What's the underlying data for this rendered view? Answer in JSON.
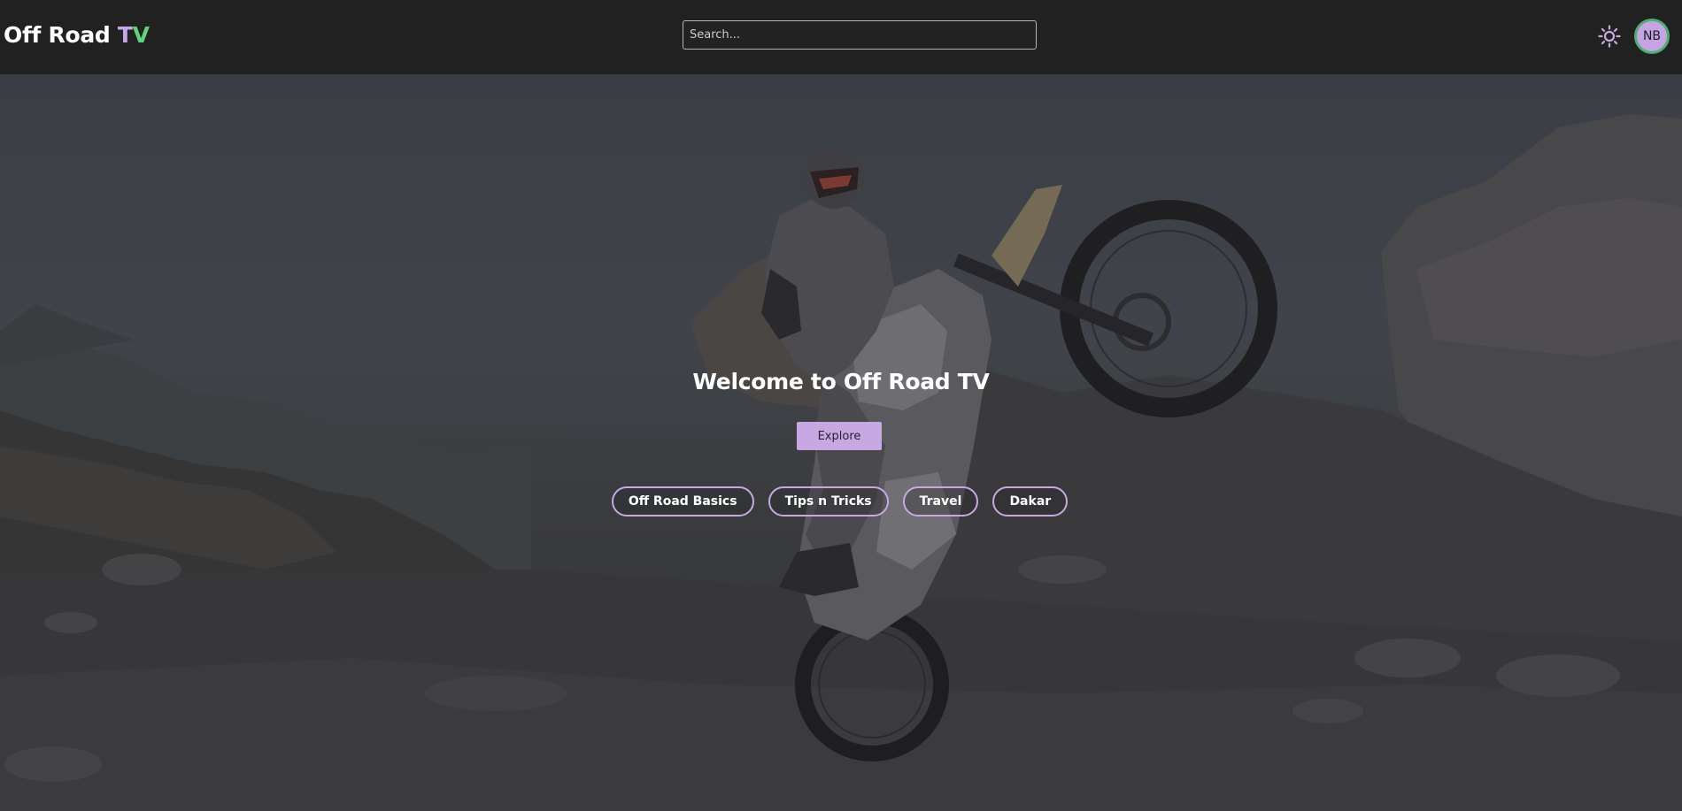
{
  "brand": {
    "name_prefix": "Off Road ",
    "name_t": "T",
    "name_v": "V"
  },
  "search": {
    "placeholder": "Search..."
  },
  "header": {
    "theme_icon": "sun-icon",
    "avatar_initials": "NB"
  },
  "hero": {
    "title": "Welcome to Off Road TV",
    "explore_label": "Explore",
    "categories": [
      "Off Road Basics",
      "Tips n Tricks",
      "Travel",
      "Dakar"
    ]
  },
  "colors": {
    "accent": "#c7a8e3",
    "brand_green": "#5ed37a",
    "navbar": "#212121"
  }
}
